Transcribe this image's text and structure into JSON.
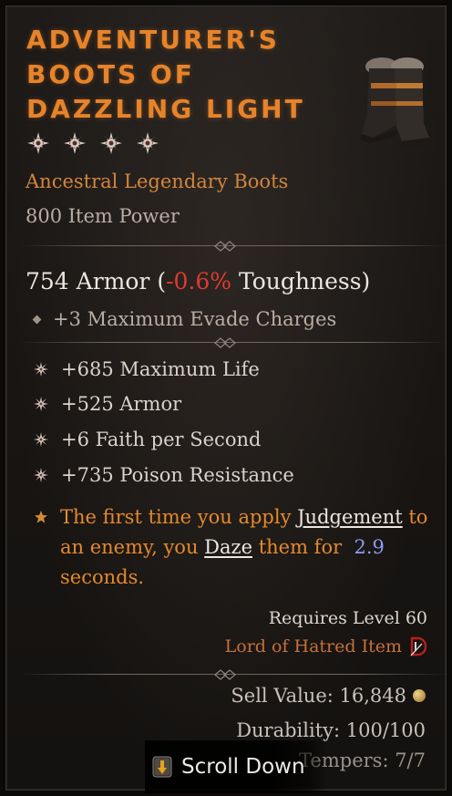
{
  "item": {
    "name": "Adventurer's\nBoots of\nDazzling Light",
    "stars": 4,
    "type": "Ancestral Legendary Boots",
    "item_power": "800 Item Power",
    "armor_value": "754 Armor (",
    "toughness_change": "-0.6%",
    "armor_suffix": " Toughness)",
    "implicit": "+3 Maximum Evade Charges",
    "affixes": [
      "+685 Maximum Life",
      "+525 Armor",
      "+6 Faith per Second",
      "+735 Poison Resistance"
    ],
    "aspect": {
      "part1": "The first time you apply ",
      "link1": "Judgement",
      "part2": " to an enemy, you ",
      "link2": "Daze",
      "part3": " them for ",
      "number": "2.9",
      "part4": " seconds."
    },
    "requires": "Requires Level 60",
    "expansion": "Lord of Hatred Item",
    "sell_value": "Sell Value: 16,848",
    "durability": "Durability: 100/100",
    "tempers": "Tempers: 7/7"
  },
  "scroll_button": {
    "label": "Scroll Down"
  },
  "colors": {
    "title": "#e7832a",
    "aspect": "#e5892c",
    "negative": "#e03a2f",
    "number": "#8a9df0"
  }
}
